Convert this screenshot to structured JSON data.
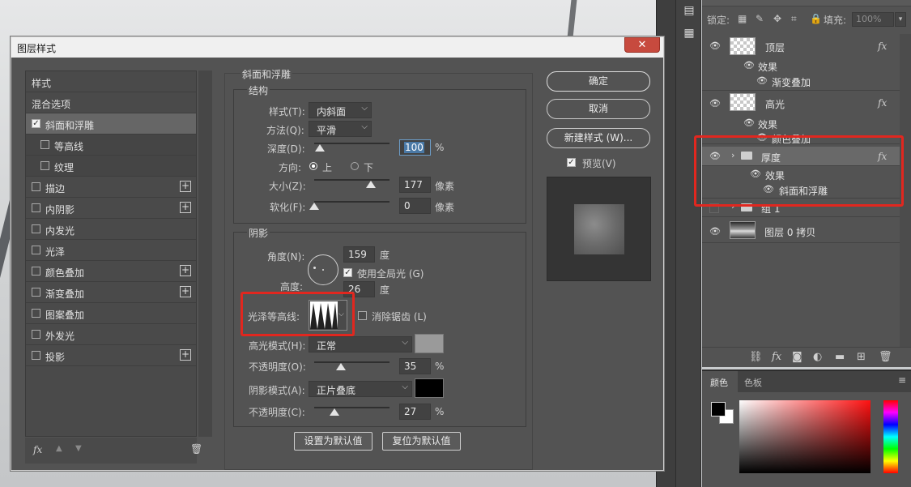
{
  "dialog": {
    "title": "图层样式",
    "close_glyph": "✕"
  },
  "style_list": {
    "items": [
      {
        "label": "样式",
        "checkbox": false,
        "checked": false,
        "plus": false,
        "active": false
      },
      {
        "label": "混合选项",
        "checkbox": false,
        "checked": false,
        "plus": false,
        "active": false
      },
      {
        "label": "斜面和浮雕",
        "checkbox": true,
        "checked": true,
        "plus": false,
        "active": true
      },
      {
        "label": "等高线",
        "checkbox": true,
        "checked": false,
        "plus": false,
        "active": false,
        "sub": true
      },
      {
        "label": "纹理",
        "checkbox": true,
        "checked": false,
        "plus": false,
        "active": false,
        "sub": true
      },
      {
        "label": "描边",
        "checkbox": true,
        "checked": false,
        "plus": true,
        "active": false
      },
      {
        "label": "内阴影",
        "checkbox": true,
        "checked": false,
        "plus": true,
        "active": false
      },
      {
        "label": "内发光",
        "checkbox": true,
        "checked": false,
        "plus": false,
        "active": false
      },
      {
        "label": "光泽",
        "checkbox": true,
        "checked": false,
        "plus": false,
        "active": false
      },
      {
        "label": "颜色叠加",
        "checkbox": true,
        "checked": false,
        "plus": true,
        "active": false
      },
      {
        "label": "渐变叠加",
        "checkbox": true,
        "checked": false,
        "plus": true,
        "active": false
      },
      {
        "label": "图案叠加",
        "checkbox": true,
        "checked": false,
        "plus": false,
        "active": false
      },
      {
        "label": "外发光",
        "checkbox": true,
        "checked": false,
        "plus": false,
        "active": false
      },
      {
        "label": "投影",
        "checkbox": true,
        "checked": false,
        "plus": true,
        "active": false
      }
    ],
    "footer": {
      "fx": "fx",
      "up": "▲",
      "down": "▼",
      "trash": "🗑"
    }
  },
  "bevel": {
    "section_title": "斜面和浮雕",
    "structure": {
      "title": "结构",
      "style_label": "样式(T):",
      "style_value": "内斜面",
      "technique_label": "方法(Q):",
      "technique_value": "平滑",
      "depth_label": "深度(D):",
      "depth_value": "100",
      "depth_unit": "%",
      "direction_label": "方向:",
      "direction_up": "上",
      "direction_down": "下",
      "size_label": "大小(Z):",
      "size_value": "177",
      "size_unit": "像素",
      "soften_label": "软化(F):",
      "soften_value": "0",
      "soften_unit": "像素"
    },
    "shading": {
      "title": "阴影",
      "angle_label": "角度(N):",
      "angle_value": "159",
      "angle_unit": "度",
      "global_light_label": "使用全局光 (G)",
      "global_light_checked": true,
      "altitude_label": "高度:",
      "altitude_value": "26",
      "altitude_unit": "度",
      "gloss_contour_label": "光泽等高线:",
      "anti_alias_label": "消除锯齿 (L)",
      "anti_alias_checked": false,
      "highlight_mode_label": "高光模式(H):",
      "highlight_mode_value": "正常",
      "highlight_color": "#9a9a9a",
      "highlight_opacity_label": "不透明度(O):",
      "highlight_opacity_value": "35",
      "highlight_opacity_unit": "%",
      "shadow_mode_label": "阴影模式(A):",
      "shadow_mode_value": "正片叠底",
      "shadow_color": "#000000",
      "shadow_opacity_label": "不透明度(C):",
      "shadow_opacity_value": "27",
      "shadow_opacity_unit": "%"
    },
    "slider_levels": {
      "depth": 0.07,
      "size": 0.75,
      "soften": 0.0,
      "highlight_opacity": 0.35,
      "shadow_opacity": 0.27
    },
    "make_default_label": "设置为默认值",
    "reset_default_label": "复位为默认值"
  },
  "actions": {
    "ok_label": "确定",
    "cancel_label": "取消",
    "new_style_label": "新建样式 (W)...",
    "preview_label": "预览(V)",
    "preview_checked": true
  },
  "layers_panel": {
    "lock_label": "锁定:",
    "fill_label": "填充:",
    "fill_value": "100%",
    "layers": [
      {
        "name": "顶层",
        "effects_label": "效果",
        "effects": [
          "渐变叠加"
        ],
        "fx": "fx"
      },
      {
        "name": "高光",
        "effects_label": "效果",
        "effects": [
          "颜色叠加"
        ],
        "fx": "fx"
      },
      {
        "name": "厚度",
        "effects_label": "效果",
        "effects": [
          "斜面和浮雕"
        ],
        "fx": "fx",
        "group": true,
        "selected": true
      },
      {
        "name": "组 1",
        "group": true
      },
      {
        "name": "图层 0 拷贝"
      }
    ]
  },
  "color_panel": {
    "tabs": [
      "颜色",
      "色板"
    ],
    "foreground": "#000000",
    "background": "#ffffff",
    "accent_hue": "#ff0000"
  },
  "highlight_color": "#e1271f"
}
